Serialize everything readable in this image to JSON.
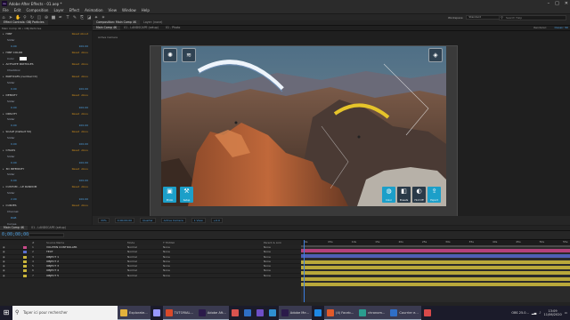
{
  "app": {
    "title": "Adobe After Effects - 01.aep *"
  },
  "menu": [
    "File",
    "Edit",
    "Composition",
    "Layer",
    "Effect",
    "Animation",
    "View",
    "Window",
    "Help"
  ],
  "workspace": {
    "label": "Workspace:",
    "value": "Standard"
  },
  "search_help": {
    "placeholder": "Search Help"
  },
  "effect_controls": {
    "tab": "Effect Controls: OBJ Particles",
    "subtitle": "Main Comp 4K • OBJ Particles",
    "items": [
      {
        "label": "HINT",
        "reset": "Reset",
        "about": "About"
      },
      {
        "label": "Slider",
        "value": "0.00",
        "max": "100.00"
      },
      {
        "label": "HINT COLOR",
        "reset": "Reset",
        "about": "Abou"
      },
      {
        "label": "Color"
      },
      {
        "label": "ACTIVATE PARTICLES",
        "reset": "Reset",
        "about": "Abou"
      },
      {
        "label": "Checkbox"
      },
      {
        "label": "PARTICLES (number=0)",
        "reset": "Reset",
        "about": "Abou"
      },
      {
        "label": "Slider",
        "value": "0.00",
        "max": "100.00"
      },
      {
        "label": "DENSITY",
        "reset": "Reset",
        "about": "Abou"
      },
      {
        "label": "Slider",
        "value": "0.00",
        "max": "100.00"
      },
      {
        "label": "OPACITY",
        "reset": "Reset",
        "about": "Abou"
      },
      {
        "label": "Slider",
        "value": "0.00",
        "max": "100.00"
      },
      {
        "label": "SCALE (Default 50)",
        "reset": "Reset",
        "about": "Abou"
      },
      {
        "label": "Slider",
        "value": "0.00",
        "max": "100.00"
      },
      {
        "label": "CHAOS",
        "reset": "Reset",
        "about": "Abou"
      },
      {
        "label": "Slider",
        "value": "0.00",
        "max": "100.00"
      },
      {
        "label": "3D INTENSITY",
        "reset": "Reset",
        "about": "Abou"
      },
      {
        "label": "Slider",
        "value": "0.00",
        "max": "100.00"
      },
      {
        "label": "CUSTOM ...LE RANDOM",
        "reset": "Reset",
        "about": "Abou"
      },
      {
        "label": "Slider",
        "value": "2.00",
        "max": "100.00"
      },
      {
        "label": "CURVES",
        "reset": "Reset",
        "about": "Abou"
      },
      {
        "label": "Channel:",
        "value": "RGB"
      },
      {
        "label": "Curves"
      }
    ]
  },
  "viewer": {
    "tabs": [
      "Composition: Main Comp 4K",
      "Layer: (none)"
    ],
    "comp_tabs": [
      "Main Comp 4K",
      "01 - LANDSCAPE (setup)",
      "01 - Photo"
    ],
    "camera": "Active Camera",
    "renderer": "Renderer:",
    "renderer_value": "Classic 3D",
    "zoom": "33%",
    "timecode": "0;00;00;00",
    "quality": "Quarter",
    "view": "Active Camera",
    "views": "1 View",
    "offset": "+0.0",
    "overlay": {
      "photo_label": "Photo",
      "setup_label": "Setup",
      "color_label": "Color",
      "preset_label": "Presets",
      "hint_label": "Hint Off",
      "export_label": "Export"
    }
  },
  "timeline": {
    "tabs": [
      "Main Comp 4K",
      "01 - LANDSCAPE (setup)"
    ],
    "time": "0;00;00;00",
    "columns": [
      "#",
      "Source Name",
      "Mode",
      "T TrkMat",
      "Parent & Link"
    ],
    "ruler": [
      "0s",
      "05s",
      "10s",
      "15s",
      "20s",
      "25s",
      "30s",
      "35s",
      "40s",
      "45s",
      "50s",
      "55s"
    ],
    "layers": [
      {
        "num": "1",
        "name": "VOLPHIN CONTROLLER",
        "mode": "Normal",
        "trk": "None",
        "parent": "None",
        "color": "#c94a8a",
        "bar": "#b4417a",
        "bar_label": ""
      },
      {
        "num": "2",
        "name": "TEXT",
        "mode": "Normal",
        "trk": "None",
        "parent": "None",
        "color": "#5a6fd0",
        "bar": "#4f5fb5",
        "bar_label": ""
      },
      {
        "num": "3",
        "name": "OBJECT 1",
        "mode": "Normal",
        "trk": "None",
        "parent": "None",
        "color": "#c8b43a",
        "bar": "#b9a83a",
        "bar_label": ""
      },
      {
        "num": "4",
        "name": "OBJECT 2",
        "mode": "Normal",
        "trk": "None",
        "parent": "None",
        "color": "#c8b43a",
        "bar": "#b9a83a",
        "bar_label": ""
      },
      {
        "num": "5",
        "name": "OBJECT 3",
        "mode": "Normal",
        "trk": "None",
        "parent": "None",
        "color": "#c8b43a",
        "bar": "#b9a83a",
        "bar_label": ""
      },
      {
        "num": "6",
        "name": "OBJECT 4",
        "mode": "Normal",
        "trk": "None",
        "parent": "None",
        "color": "#c8b43a",
        "bar": "#b9a83a",
        "bar_label": ""
      },
      {
        "num": "7",
        "name": "OBJECT 5",
        "mode": "Normal",
        "trk": "None",
        "parent": "None",
        "color": "#c8b43a",
        "bar": "#b9a83a",
        "bar_label": ""
      }
    ]
  },
  "taskbar": {
    "search_placeholder": "Taper ici pour rechercher",
    "items": [
      {
        "label": "Explorate...",
        "color": "#e3b23c",
        "icon": "folder-icon"
      },
      {
        "label": "",
        "color": "#9999ff",
        "icon": "ae-icon"
      },
      {
        "label": "TUTORIAL...",
        "color": "#d94a2a",
        "icon": "ppt-icon"
      },
      {
        "label": "Adobe Aft...",
        "color": "#2b1a4a",
        "icon": "ae-icon"
      },
      {
        "label": "",
        "color": "#d9534f",
        "icon": "app-icon"
      },
      {
        "label": "",
        "color": "#2f6fc7",
        "icon": "app-icon"
      },
      {
        "label": "",
        "color": "#6e4fc7",
        "icon": "app-icon"
      },
      {
        "label": "",
        "color": "#2f8fd0",
        "icon": "app-icon"
      },
      {
        "label": "Adobe Me...",
        "color": "#2b1a4a",
        "icon": "me-icon"
      },
      {
        "label": "",
        "color": "#1e88e5",
        "icon": "app-icon"
      },
      {
        "label": "(4) Faceb...",
        "color": "#e25a2a",
        "icon": "firefox-icon"
      },
      {
        "label": "chronom...",
        "color": "#2a9d8f",
        "icon": "chrome-icon"
      },
      {
        "label": "Courrier e...",
        "color": "#2f6fc7",
        "icon": "mail-icon"
      },
      {
        "label": "",
        "color": "#d94a4a",
        "icon": "app-icon"
      }
    ],
    "tray_text": "OBS 25.0...",
    "time": "13:09",
    "date": "11/06/2020"
  }
}
